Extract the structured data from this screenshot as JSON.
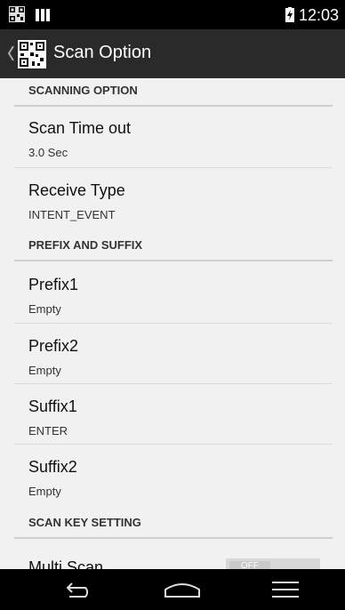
{
  "status_bar": {
    "time": "12:03",
    "icons": [
      "qr-notification-icon",
      "signal-icon",
      "battery-charging-icon"
    ]
  },
  "action_bar": {
    "title": "Scan Option",
    "icons": [
      "up-caret-icon",
      "qr-app-icon"
    ]
  },
  "sections": [
    {
      "header": "SCANNING OPTION",
      "items": [
        {
          "title": "Scan Time out",
          "summary": "3.0 Sec"
        },
        {
          "title": "Receive Type",
          "summary": "INTENT_EVENT"
        }
      ]
    },
    {
      "header": "PREFIX AND SUFFIX",
      "items": [
        {
          "title": "Prefix1",
          "summary": "Empty"
        },
        {
          "title": "Prefix2",
          "summary": "Empty"
        },
        {
          "title": "Suffix1",
          "summary": "ENTER"
        },
        {
          "title": "Suffix2",
          "summary": "Empty"
        }
      ]
    },
    {
      "header": "SCAN KEY SETTING",
      "items": [
        {
          "title": "Multi Scan",
          "toggle": "OFF"
        }
      ]
    }
  ],
  "nav_bar": {
    "icons": [
      "back-icon",
      "home-icon",
      "recent-apps-icon"
    ]
  }
}
